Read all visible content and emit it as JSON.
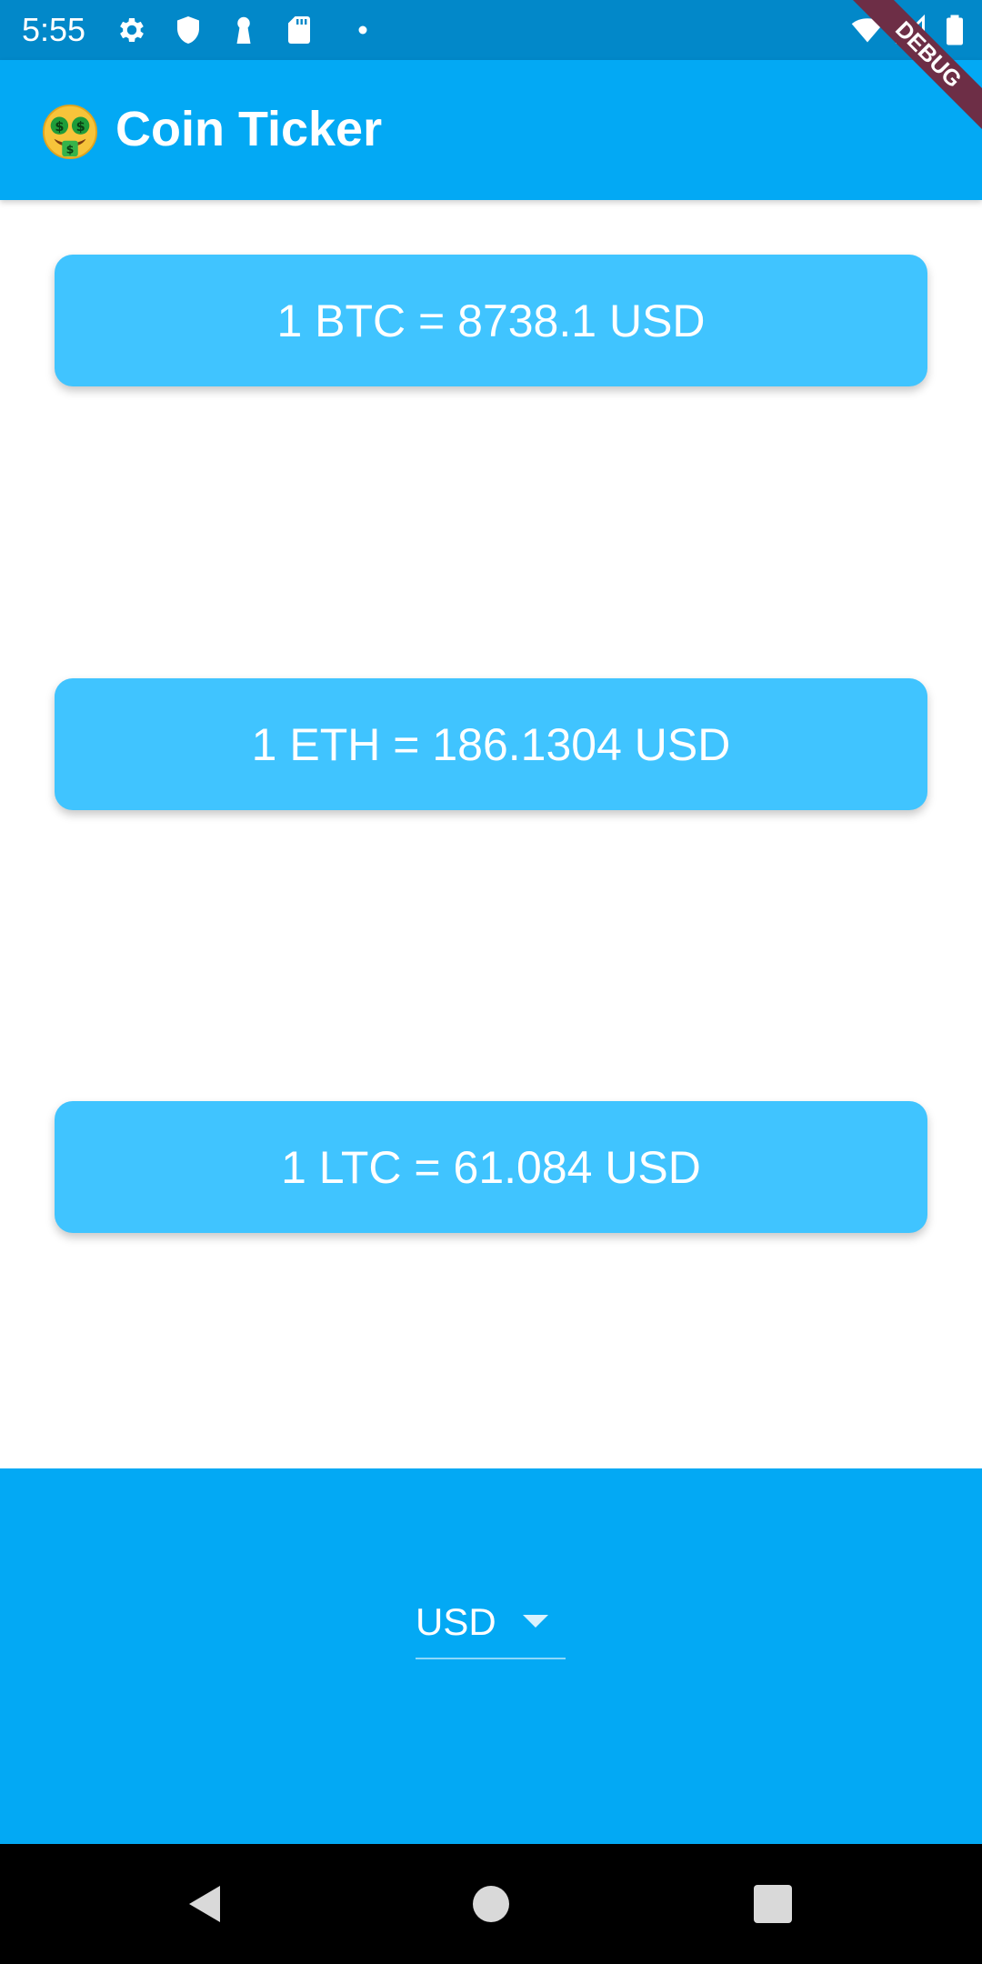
{
  "status_bar": {
    "time": "5:55",
    "icons": [
      "gear-icon",
      "shield-icon",
      "keyhole-icon",
      "sd-card-icon",
      "dot-icon",
      "wifi-icon",
      "signal-icon",
      "battery-icon"
    ]
  },
  "debug_banner": {
    "label": "DEBUG",
    "color": "#6d2e46"
  },
  "app_bar": {
    "title": "Coin Ticker",
    "emoji": "money-mouth-face-icon",
    "color": "#03a9f4"
  },
  "rates": [
    {
      "coin": "BTC",
      "text": "1 BTC = 8738.1 USD"
    },
    {
      "coin": "ETH",
      "text": "1 ETH = 186.1304 USD"
    },
    {
      "coin": "LTC",
      "text": "1 LTC = 61.084 USD"
    }
  ],
  "card_color": "#40c4ff",
  "currency_picker": {
    "selected": "USD",
    "icon": "dropdown-arrow-icon"
  },
  "nav_bar": {
    "buttons": [
      "back-icon",
      "home-icon",
      "recents-icon"
    ]
  }
}
